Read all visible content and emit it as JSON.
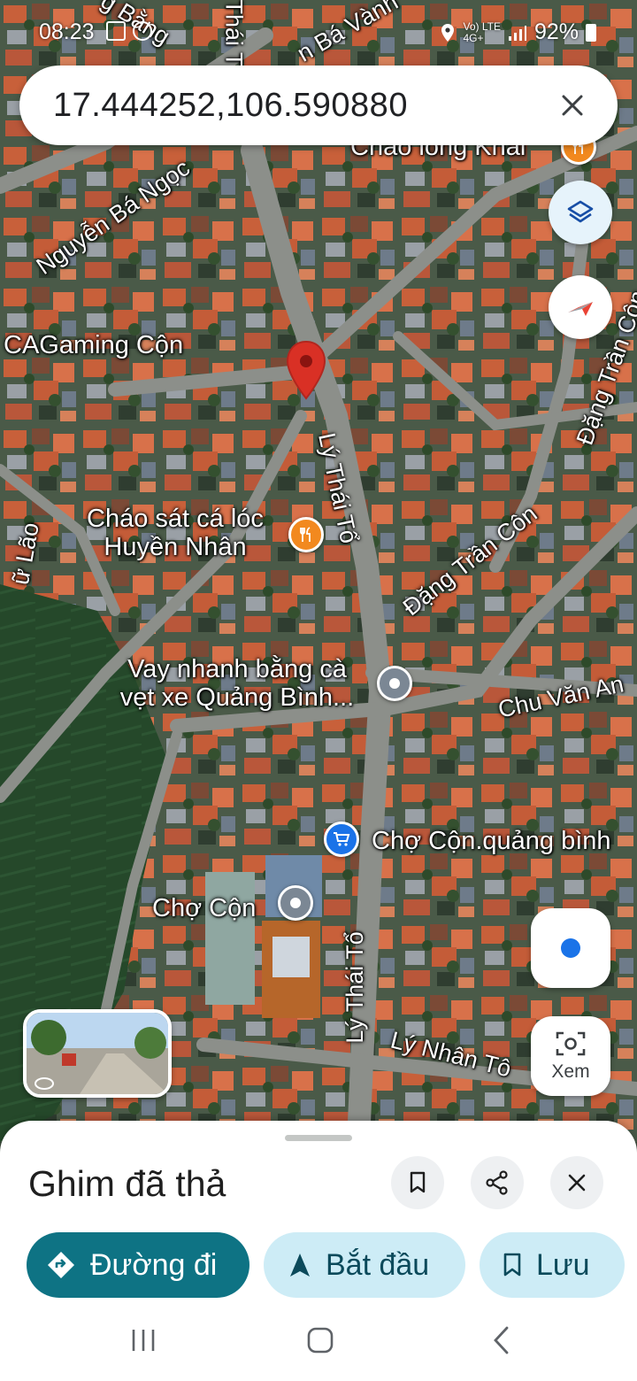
{
  "status_bar": {
    "time": "08:23",
    "network": "4G+",
    "network_sub": "Vo) LTE",
    "battery": "92%"
  },
  "search": {
    "query": "17.444252,106.590880"
  },
  "map": {
    "streets": {
      "nguyen_ba_ngoc": "Nguyễn Bá Ngọc",
      "top_fragment_1": "g Bằng",
      "top_fragment_2": "Thái T",
      "top_fragment_3": "n Bá Vành",
      "ly_thai_to_upper": "Lý Thái Tổ",
      "ly_thai_to_lower": "Lý Thái Tổ",
      "dang_tran_con_right": "Đặng Trần Côn",
      "dang_tran_con_mid": "Đặng Trần Côn",
      "chu_van_an": "Chu Văn An",
      "ly_nhan_tong": "Lý Nhân Tô",
      "left_fragment": "ữ Lão"
    },
    "places": {
      "chao_long_khai": "Cháo lòng Khải",
      "cagaming": "CAGaming Cộn",
      "chao_sat_line1": "Cháo sát cá lóc",
      "chao_sat_line2": "Huyền Nhân",
      "vay_nhanh_line1": "Vay nhanh bằng cà",
      "vay_nhanh_line2": "vẹt xe Quảng Bình...",
      "cho_con_shop": "Chợ Cộn.quảng bình",
      "cho_con": "Chợ Cộn"
    },
    "pin_color": "#d93025"
  },
  "controls": {
    "lens_label": "Xem"
  },
  "sheet": {
    "title": "Ghim đã thả",
    "directions_label": "Đường đi",
    "start_label": "Bắt đầu",
    "save_label": "Lưu",
    "accent": "#0e7384",
    "tonal": "#cdecf6"
  }
}
